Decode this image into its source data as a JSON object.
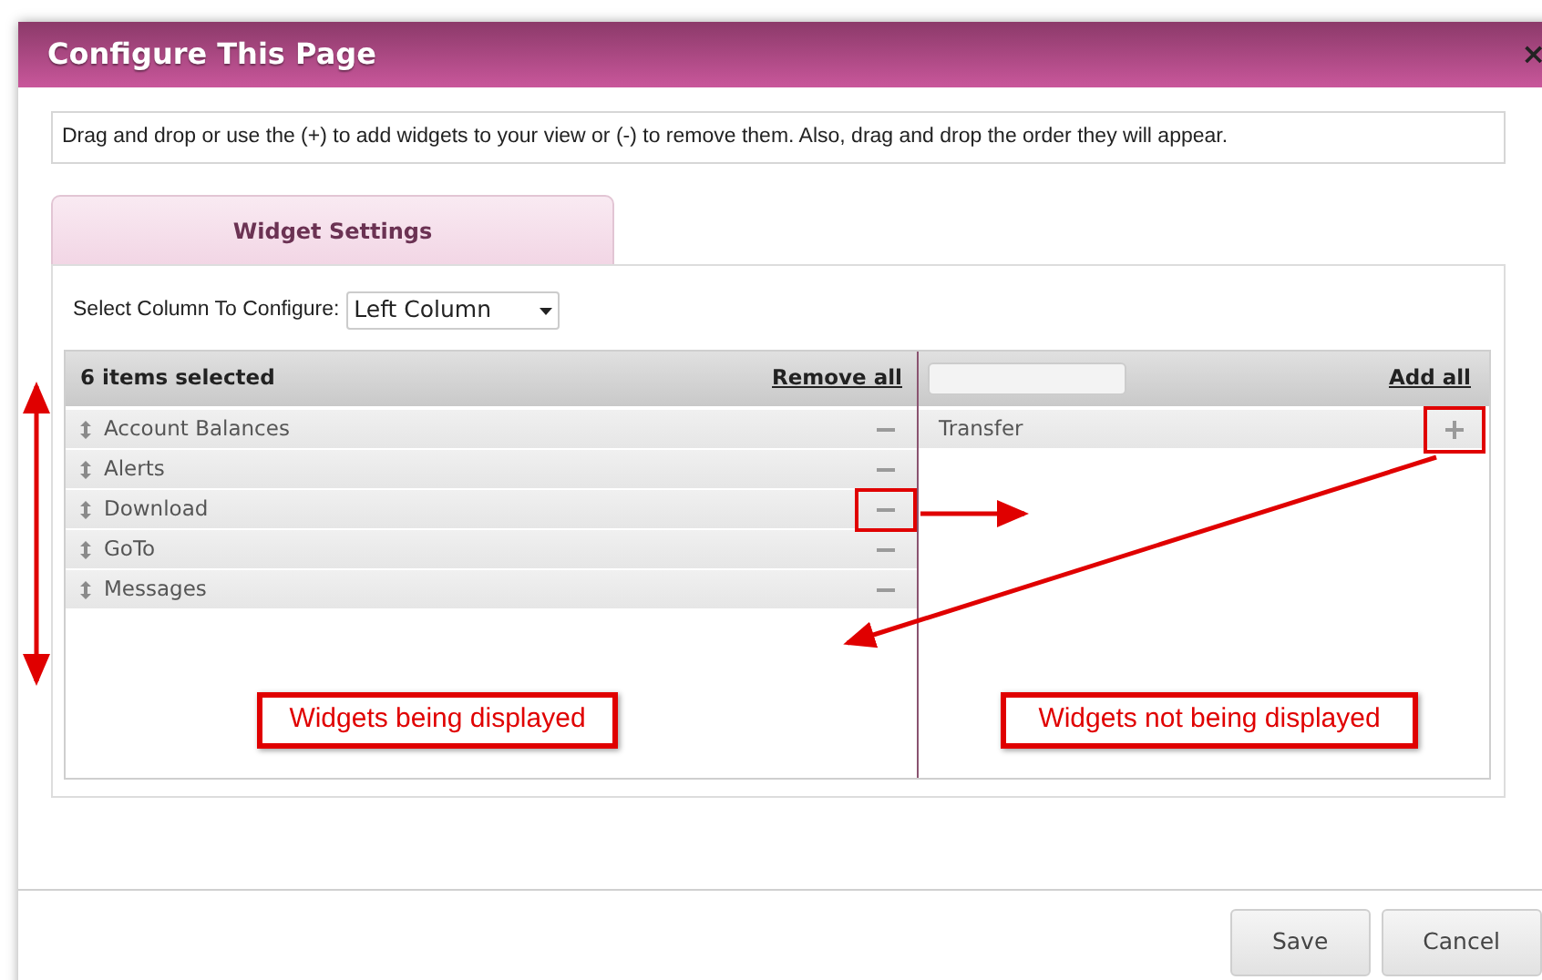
{
  "dialog": {
    "title": "Configure This Page",
    "close": "×"
  },
  "instructions": "Drag and drop or use the (+) to add widgets to your view or (-) to remove them. Also, drag and drop the order they will appear.",
  "tabs": [
    {
      "label": "Widget Settings",
      "selected": true
    }
  ],
  "column_select": {
    "label": "Select Column To Configure:",
    "value": "Left Column"
  },
  "displayed": {
    "header": "6 items selected",
    "action": "Remove all",
    "items": [
      {
        "label": "Account Balances",
        "highlighted": false
      },
      {
        "label": "Alerts",
        "highlighted": false
      },
      {
        "label": "Download",
        "highlighted": true
      },
      {
        "label": "GoTo",
        "highlighted": false
      },
      {
        "label": "Messages",
        "highlighted": false
      }
    ]
  },
  "available": {
    "action": "Add all",
    "items": [
      {
        "label": "Transfer",
        "highlighted": true
      }
    ]
  },
  "callouts": [
    {
      "text": "Widgets being displayed"
    },
    {
      "text": "Widgets not being displayed"
    }
  ],
  "buttons": [
    {
      "label": "Save"
    },
    {
      "label": "Cancel"
    }
  ]
}
